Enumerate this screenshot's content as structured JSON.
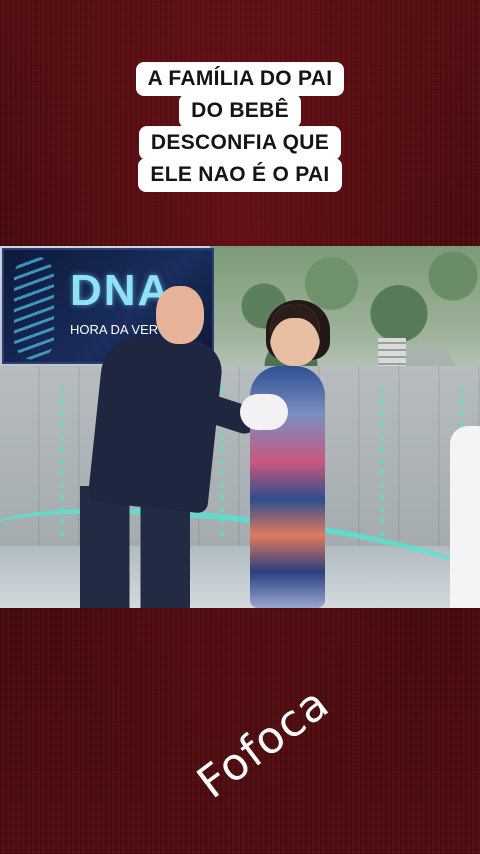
{
  "caption": {
    "lines": [
      "A FAMÍLIA DO PAI",
      "DO BEBÊ",
      "DESCONFIA QUE",
      "ELE NAO É O PAI"
    ]
  },
  "video": {
    "logo_text": "DNA",
    "logo_subtitle": "HORA DA VER"
  },
  "watermark": {
    "text": "Fofoca"
  },
  "colors": {
    "background": "#5a0f12",
    "caption_bg": "#ffffff",
    "caption_text": "#141414",
    "stage_glow": "#54e6d4"
  }
}
